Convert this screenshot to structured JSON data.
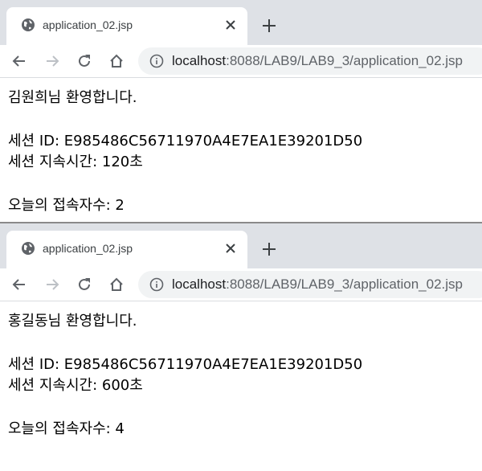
{
  "windows": [
    {
      "tab_title": "application_02.jsp",
      "url_host": "localhost",
      "url_path": ":8088/LAB9/LAB9_3/application_02.jsp",
      "welcome": "김원희님 환영합니다.",
      "session_id": "세션 ID: E985486C56711970A4E7EA1E39201D50",
      "session_time": "세션 지속시간: 120초",
      "visitors": "오늘의 접속자수: 2"
    },
    {
      "tab_title": "application_02.jsp",
      "url_host": "localhost",
      "url_path": ":8088/LAB9/LAB9_3/application_02.jsp",
      "welcome": "홍길동님 환영합니다.",
      "session_id": "세션 ID: E985486C56711970A4E7EA1E39201D50",
      "session_time": "세션 지속시간: 600초",
      "visitors": "오늘의 접속자수: 4"
    }
  ],
  "icons": {
    "favicon": "globe-icon",
    "close": "close-icon",
    "new_tab": "plus-icon",
    "back": "back-arrow-icon",
    "forward": "forward-arrow-icon",
    "reload": "reload-icon",
    "home": "home-icon",
    "site_info": "info-icon"
  }
}
